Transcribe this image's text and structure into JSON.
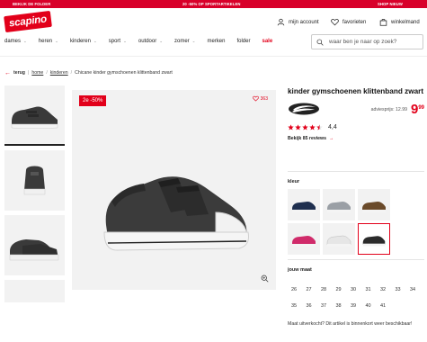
{
  "promo_bar": {
    "left": "BEKIJK DE FOLDER",
    "center": "20 -50% OP SPORTARTIKELEN",
    "right": "SHOP NIEUW"
  },
  "brand_colors": {
    "accent": "#e2001a",
    "promo_bg": "#d8002a"
  },
  "header": {
    "logo_text": "scapino",
    "account_label": "mijn account",
    "favorites_label": "favorieten",
    "cart_label": "winkelmand"
  },
  "nav": {
    "items": [
      "dames",
      "heren",
      "kinderen",
      "sport",
      "outdoor",
      "zomer"
    ],
    "plain_items": [
      "merken",
      "folder"
    ],
    "sale_label": "sale"
  },
  "search": {
    "placeholder": "waar ben je naar op zoek?"
  },
  "breadcrumb": {
    "back_label": "terug",
    "items": [
      "home",
      "kinderen"
    ],
    "current": "Chicane kinder gymschoenen klittenband zwart"
  },
  "gallery": {
    "badge": "2e -50%",
    "wishlist_count": "363"
  },
  "product": {
    "title": "kinder gymschoenen klittenband zwart",
    "advice_price_label": "adviesprijs: 12.99",
    "price_whole": "9",
    "price_cents": "99",
    "rating_value": "4,4",
    "rating_stars": 4.4,
    "reviews_label": "Bekijk 85 reviews"
  },
  "color_section": {
    "label": "kleur",
    "swatches": [
      {
        "name": "navy",
        "color": "#1f2f4f"
      },
      {
        "name": "grey",
        "color": "#9a9fa5"
      },
      {
        "name": "brown",
        "color": "#6a4a2a"
      },
      {
        "name": "pink",
        "color": "#d02b6a"
      },
      {
        "name": "white",
        "color": "#e6e6e6"
      },
      {
        "name": "black",
        "color": "#2b2b2b",
        "selected": true
      }
    ]
  },
  "size_section": {
    "label": "jouw maat",
    "sizes": [
      "26",
      "27",
      "28",
      "29",
      "30",
      "31",
      "32",
      "33",
      "34",
      "35",
      "36",
      "37",
      "38",
      "39",
      "40",
      "41"
    ]
  },
  "stock_hint": "Maat uitverkocht? Dit artikel is binnenkort weer beschikbaar!"
}
